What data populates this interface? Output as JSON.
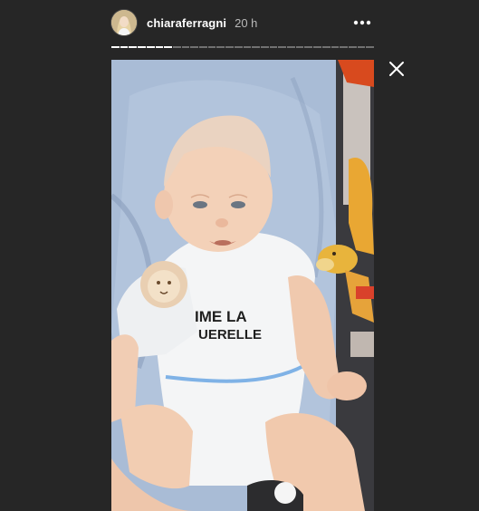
{
  "story": {
    "username": "chiaraferragni",
    "time_ago": "20 h",
    "progress": {
      "segments_total": 30,
      "segments_viewed": 7
    },
    "shirt_text_line1": "IME LA",
    "shirt_text_line2": "UERELLE"
  },
  "icons": {
    "more": "more-options-icon",
    "close": "close-icon"
  },
  "colors": {
    "background": "#262626",
    "text_primary": "#ffffff",
    "text_secondary": "#b9b9b9"
  }
}
